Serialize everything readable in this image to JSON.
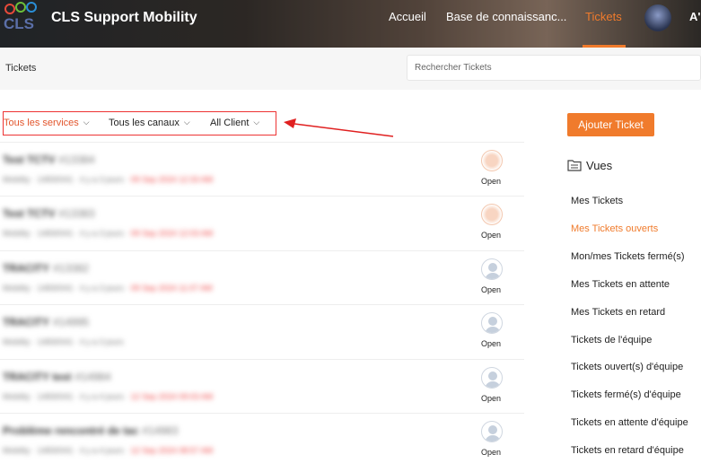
{
  "header": {
    "brand": "CLS Support Mobility",
    "logo_text": "CLS",
    "nav": [
      {
        "label": "Accueil"
      },
      {
        "label": "Base de connaissanc..."
      },
      {
        "label": "Tickets",
        "active": true
      }
    ],
    "extra": "A'",
    "accent_color": "#f07b2c"
  },
  "subbar": {
    "breadcrumb": "Tickets",
    "search_placeholder": "Rechercher Tickets"
  },
  "filters": [
    {
      "label": "Tous les services",
      "color": "#e2562d"
    },
    {
      "label": "Tous les canaux",
      "color": "#222222"
    },
    {
      "label": "All Client",
      "color": "#222222"
    }
  ],
  "tickets": [
    {
      "title": "Test TCTV",
      "id": "#13384",
      "meta": "Mobility · 14830041 · il y a 3 jours · ",
      "date": "09 Sep 2024 12:33 AM",
      "avatar": "orange",
      "status": "Open"
    },
    {
      "title": "Test TCTV",
      "id": "#13383",
      "meta": "Mobility · 14830041 · il y a 3 jours · ",
      "date": "09 Sep 2024 12:03 AM",
      "avatar": "orange",
      "status": "Open"
    },
    {
      "title": "TRACITY",
      "id": "#13382",
      "meta": "Mobility · 14830041 · il y a 3 jours · ",
      "date": "09 Sep 2024 11:07 AM",
      "avatar": "person",
      "status": "Open"
    },
    {
      "title": "TRACITY",
      "id": "#14995",
      "meta": "Mobility · 14830041 · il y a 3 jours",
      "date": "",
      "avatar": "person",
      "status": "Open"
    },
    {
      "title": "TRACITY test",
      "id": "#14984",
      "meta": "Mobility · 14830041 · il y a 4 jours · ",
      "date": "12 Sep 2024 09:03 AM",
      "avatar": "person",
      "status": "Open"
    },
    {
      "title": "Problème rencontré de tac",
      "id": "#14983",
      "meta": "Mobility · 14830041 · il y a 4 jours · ",
      "date": "12 Sep 2024 08:57 AM",
      "avatar": "person",
      "status": "Open"
    }
  ],
  "sidebar": {
    "add_button": "Ajouter Ticket",
    "views_title": "Vues",
    "views": [
      {
        "label": "Mes Tickets"
      },
      {
        "label": "Mes Tickets ouverts",
        "active": true
      },
      {
        "label": "Mon/mes Tickets fermé(s)"
      },
      {
        "label": "Mes Tickets en attente"
      },
      {
        "label": "Mes Tickets en retard"
      },
      {
        "label": "Tickets de l'équipe"
      },
      {
        "label": "Tickets ouvert(s) d'équipe"
      },
      {
        "label": "Tickets fermé(s) d'équipe"
      },
      {
        "label": "Tickets en attente d'équipe"
      },
      {
        "label": "Tickets en retard d'équipe"
      }
    ]
  }
}
